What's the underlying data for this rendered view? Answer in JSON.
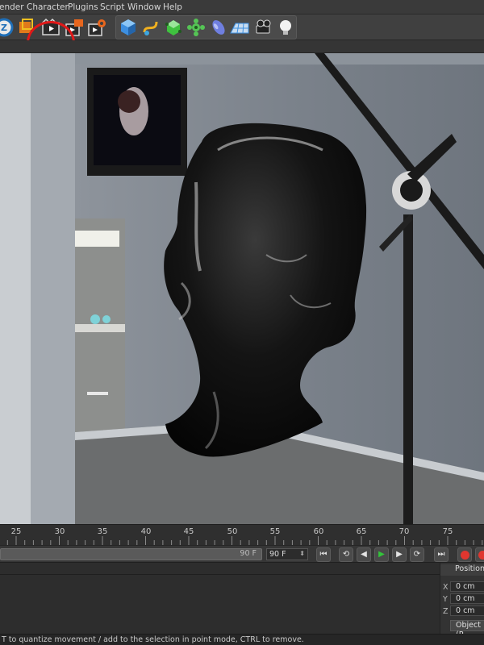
{
  "menubar": {
    "items": [
      "ender",
      "Character",
      "Plugins",
      "Script",
      "Window",
      "Help"
    ]
  },
  "toolbar": {
    "icons": [
      "cinema4d-logo-icon",
      "render-region-icon",
      "render-view-icon",
      "render-picture-viewer-icon",
      "render-settings-icon",
      "cube-icon",
      "spline-pen-icon",
      "nurbs-icon",
      "array-icon",
      "deformer-icon",
      "floor-icon",
      "camera-icon",
      "light-icon"
    ],
    "highlight_color": "#e01818"
  },
  "timeline": {
    "ticks": [
      "25",
      "30",
      "35",
      "40",
      "45",
      "50",
      "55",
      "60",
      "65",
      "70",
      "75"
    ],
    "range_end": "90 F",
    "current_frame": "90 F",
    "transport_icons": [
      "go-to-start-icon",
      "previous-key-icon",
      "step-back-icon",
      "play-icon",
      "step-forward-icon",
      "next-key-icon",
      "go-to-end-icon",
      "record-icon"
    ],
    "play_color": "#33c43a",
    "record_color": "#e0362f"
  },
  "coordinates": {
    "header": "Position",
    "axes": [
      {
        "axis": "X",
        "value": "0 cm"
      },
      {
        "axis": "Y",
        "value": "0 cm"
      },
      {
        "axis": "Z",
        "value": "0 cm"
      }
    ],
    "mode": "Object (R"
  },
  "status": {
    "text": "T to quantize movement / add to the selection in point mode, CTRL to remove."
  }
}
